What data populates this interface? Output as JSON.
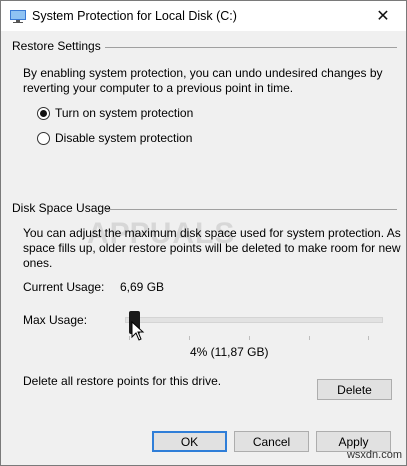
{
  "window": {
    "title": "System Protection for Local Disk (C:)",
    "close_glyph": "✕"
  },
  "restore": {
    "section_title": "Restore Settings",
    "description_line1": "By enabling system protection, you can undo undesired changes by",
    "description_line2": "reverting your computer to a previous point in time.",
    "options": [
      {
        "label": "Turn on system protection",
        "checked": true
      },
      {
        "label": "Disable system protection",
        "checked": false
      }
    ]
  },
  "disk": {
    "section_title": "Disk Space Usage",
    "description_line1": "You can adjust the maximum disk space used for system protection. As",
    "description_line2": "space fills up, older restore points will be deleted to make room for new",
    "description_line3": "ones.",
    "current_usage_label": "Current Usage:",
    "current_usage_value": "6,69 GB",
    "max_usage_label": "Max Usage:",
    "max_usage_percent": 4,
    "max_usage_text": "4% (11,87 GB)",
    "delete_text": "Delete all restore points for this drive.",
    "delete_button": "Delete"
  },
  "buttons": {
    "ok": "OK",
    "cancel": "Cancel",
    "apply": "Apply"
  },
  "watermark_logo_text": "APPUALS",
  "footer_watermark": "wsxdn.com",
  "colors": {
    "default_button_border": "#2f7ed8",
    "window_bg": "#f0f0f0"
  }
}
